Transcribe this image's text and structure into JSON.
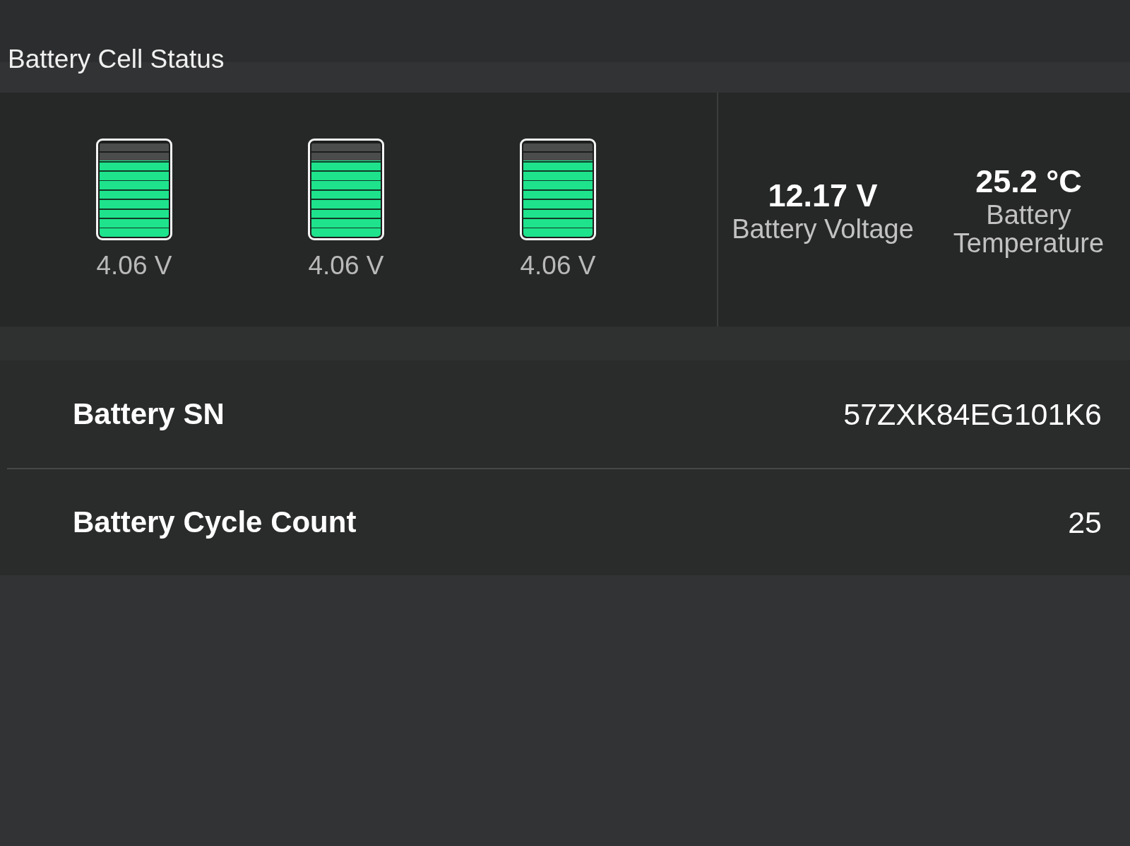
{
  "section_title": "Battery Cell Status",
  "cells": [
    {
      "level": 0.8,
      "voltage": "4.06 V"
    },
    {
      "level": 0.8,
      "voltage": "4.06 V"
    },
    {
      "level": 0.8,
      "voltage": "4.06 V"
    }
  ],
  "summary": [
    {
      "value": "12.17 V",
      "label": "Battery Voltage"
    },
    {
      "value": "25.2 °C",
      "label": "Battery Temperature"
    }
  ],
  "info_rows": [
    {
      "label": "Battery SN",
      "value": "57ZXK84EG101K6"
    },
    {
      "label": "Battery Cycle Count",
      "value": "25"
    }
  ]
}
